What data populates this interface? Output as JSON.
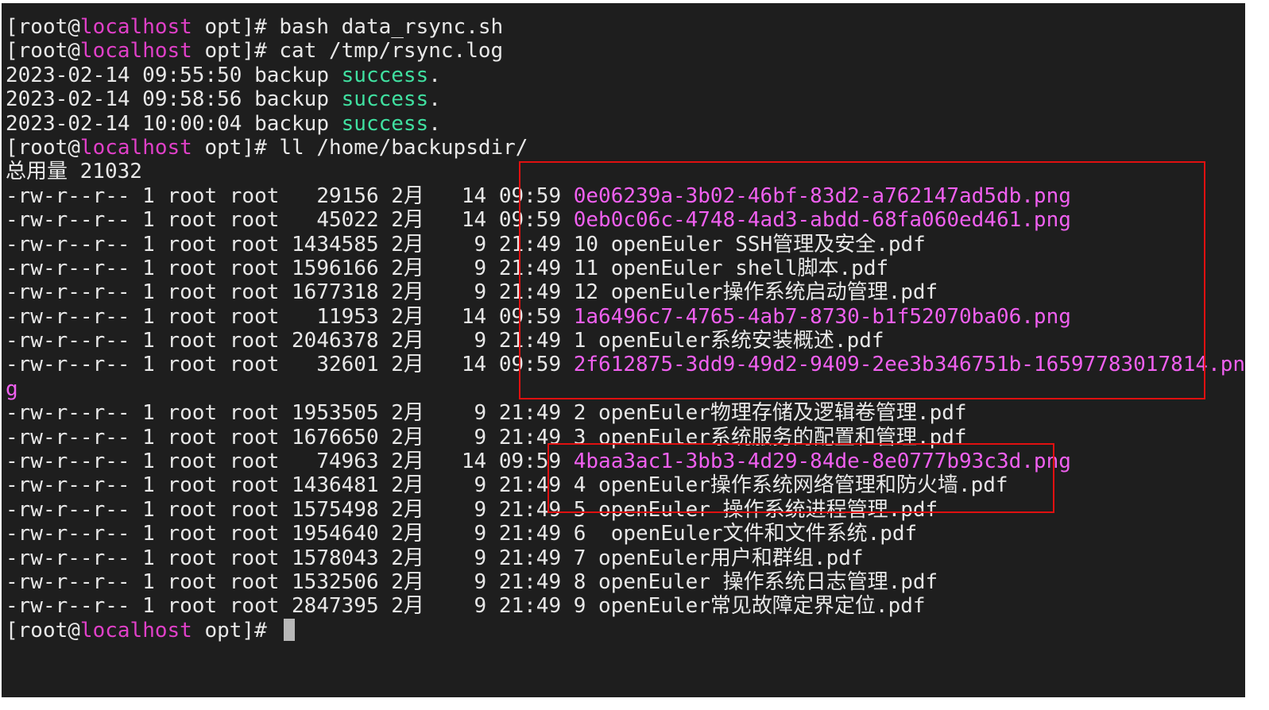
{
  "terminal": {
    "prompt": {
      "user_open": "[root@",
      "host": "localhost",
      "path_close": " opt]# "
    },
    "commands": [
      "bash data_rsync.sh",
      "cat /tmp/rsync.log",
      "ll /home/backupsdir/"
    ],
    "log": [
      {
        "timestamp": "2023-02-14 09:55:50 backup ",
        "status": "success",
        "end": "."
      },
      {
        "timestamp": "2023-02-14 09:58:56 backup ",
        "status": "success",
        "end": "."
      },
      {
        "timestamp": "2023-02-14 10:00:04 backup ",
        "status": "success",
        "end": "."
      }
    ],
    "total": "总用量 21032",
    "files": [
      {
        "meta": "-rw-r--r-- 1 root root   29156 2月   14 09:59 ",
        "name": "0e06239a-3b02-46bf-83d2-a762147ad5db.png",
        "is_image": true
      },
      {
        "meta": "-rw-r--r-- 1 root root   45022 2月   14 09:59 ",
        "name": "0eb0c06c-4748-4ad3-abdd-68fa060ed461.png",
        "is_image": true
      },
      {
        "meta": "-rw-r--r-- 1 root root 1434585 2月    9 21:49 ",
        "name": "10 openEuler SSH管理及安全.pdf",
        "is_image": false
      },
      {
        "meta": "-rw-r--r-- 1 root root 1596166 2月    9 21:49 ",
        "name": "11 openEuler shell脚本.pdf",
        "is_image": false
      },
      {
        "meta": "-rw-r--r-- 1 root root 1677318 2月    9 21:49 ",
        "name": "12 openEuler操作系统启动管理.pdf",
        "is_image": false
      },
      {
        "meta": "-rw-r--r-- 1 root root   11953 2月   14 09:59 ",
        "name": "1a6496c7-4765-4ab7-8730-b1f52070ba06.png",
        "is_image": true
      },
      {
        "meta": "-rw-r--r-- 1 root root 2046378 2月    9 21:49 ",
        "name": "1 openEuler系统安装概述.pdf",
        "is_image": false
      },
      {
        "meta": "-rw-r--r-- 1 root root   32601 2月   14 09:59 ",
        "name": "2f612875-3dd9-49d2-9409-2ee3b346751b-16597783017814.pn",
        "name_wrap": "g",
        "is_image": true
      },
      {
        "meta": "-rw-r--r-- 1 root root 1953505 2月    9 21:49 ",
        "name": "2 openEuler物理存储及逻辑卷管理.pdf",
        "is_image": false
      },
      {
        "meta": "-rw-r--r-- 1 root root 1676650 2月    9 21:49 ",
        "name": "3 openEuler系统服务的配置和管理.pdf",
        "is_image": false
      },
      {
        "meta": "-rw-r--r-- 1 root root   74963 2月   14 09:59 ",
        "name": "4baa3ac1-3bb3-4d29-84de-8e0777b93c3d.png",
        "is_image": true
      },
      {
        "meta": "-rw-r--r-- 1 root root 1436481 2月    9 21:49 ",
        "name": "4 openEuler操作系统网络管理和防火墙.pdf",
        "is_image": false
      },
      {
        "meta": "-rw-r--r-- 1 root root 1575498 2月    9 21:49 ",
        "name": "5 openEuler 操作系统进程管理.pdf",
        "is_image": false
      },
      {
        "meta": "-rw-r--r-- 1 root root 1954640 2月    9 21:49 ",
        "name": "6  openEuler文件和文件系统.pdf",
        "is_image": false
      },
      {
        "meta": "-rw-r--r-- 1 root root 1578043 2月    9 21:49 ",
        "name": "7 openEuler用户和群组.pdf",
        "is_image": false
      },
      {
        "meta": "-rw-r--r-- 1 root root 1532506 2月    9 21:49 ",
        "name": "8 openEuler 操作系统日志管理.pdf",
        "is_image": false
      },
      {
        "meta": "-rw-r--r-- 1 root root 2847395 2月    9 21:49 ",
        "name": "9 openEuler常见故障定界定位.pdf",
        "is_image": false
      }
    ]
  },
  "colors": {
    "background": "#1e1e1e",
    "text": "#e8e8e8",
    "host": "#e040c8",
    "success": "#40e0a0",
    "image_file": "#f060f0",
    "highlight_box": "#e01010"
  }
}
